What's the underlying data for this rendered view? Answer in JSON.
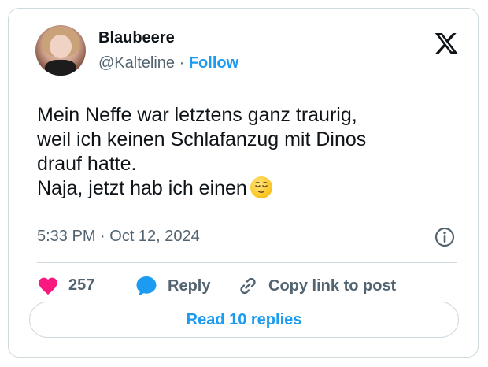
{
  "author": {
    "name": "Blaubeere",
    "handle": "@Kalteline",
    "separator": "·",
    "follow_label": "Follow"
  },
  "tweet": {
    "lines": [
      "Mein Neffe war letztens ganz traurig,",
      "weil ich keinen Schlafanzug mit Dinos",
      "drauf hatte.",
      "Naja, jetzt hab ich einen"
    ],
    "emoji": "relieved-face",
    "timestamp": "5:33 PM · Oct 12, 2024"
  },
  "actions": {
    "like_count": "257",
    "reply_label": "Reply",
    "copy_label": "Copy link to post"
  },
  "read_replies_label": "Read 10 replies",
  "colors": {
    "accent": "#1d9bf0",
    "like": "#f91880",
    "text": "#0f1419",
    "secondary": "#536471",
    "border": "#cfd9de"
  },
  "icons": [
    "x-logo-icon",
    "info-icon",
    "heart-icon",
    "reply-bubble-icon",
    "link-icon"
  ]
}
